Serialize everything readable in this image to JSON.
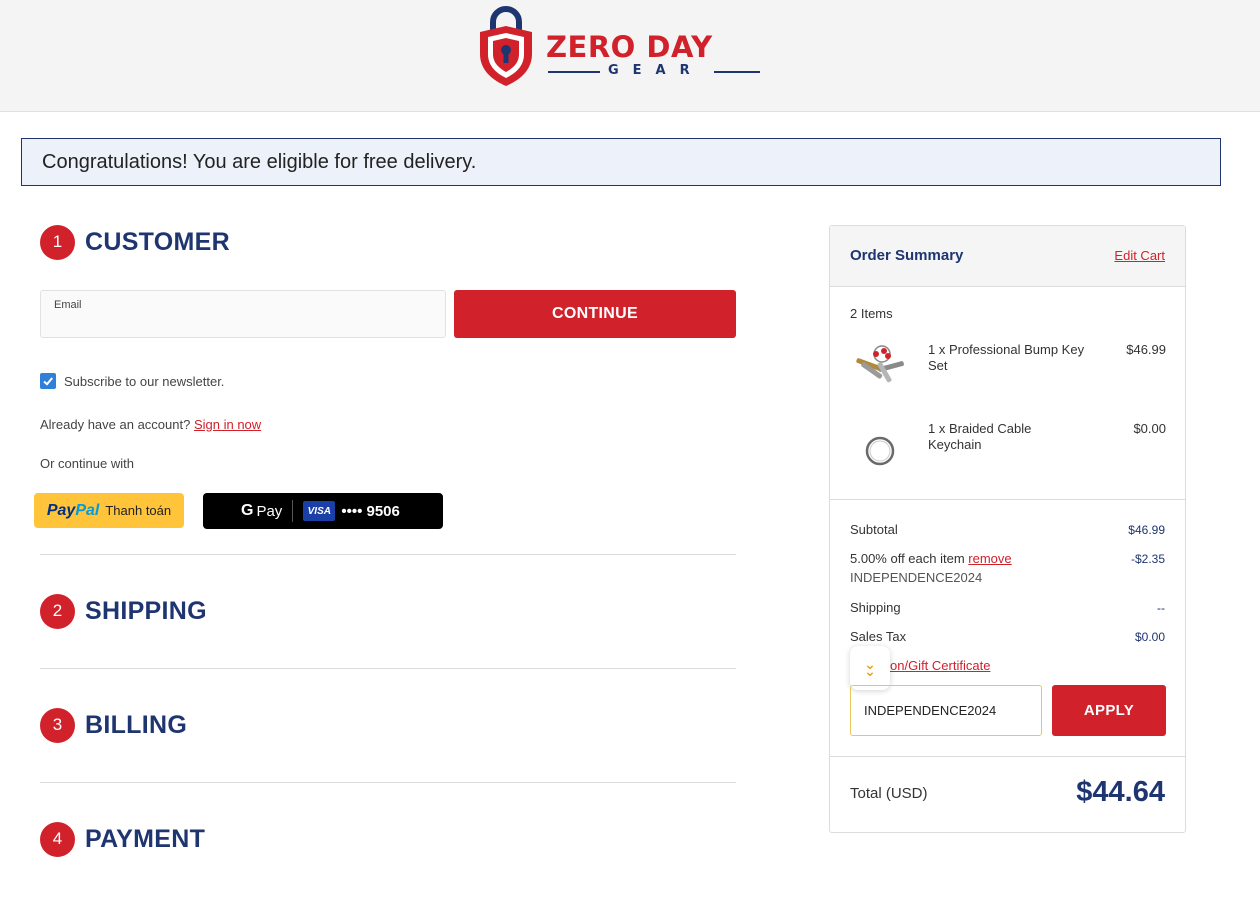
{
  "brand": {
    "name_line1": "ZERO DAY",
    "name_line2": "GEAR",
    "red": "#d1212b",
    "navy": "#1e3570"
  },
  "banner": {
    "message": "Congratulations! You are eligible for free delivery."
  },
  "customer": {
    "step_number": "1",
    "title": "CUSTOMER",
    "email_label": "Email",
    "email_value": "",
    "continue_label": "CONTINUE",
    "newsletter_label": "Subscribe to our newsletter.",
    "newsletter_checked": true,
    "account_prompt": "Already have an account?",
    "sign_in_label": "Sign in now",
    "continue_with": "Or continue with",
    "paypal_pay": "Pay",
    "paypal_pal": "Pal",
    "paypal_text": "Thanh toán",
    "gpay_g": "G",
    "gpay_label": "Pay",
    "card_brand": "VISA",
    "card_digits": "•••• 9506"
  },
  "steps": [
    {
      "number": "2",
      "title": "SHIPPING"
    },
    {
      "number": "3",
      "title": "BILLING"
    },
    {
      "number": "4",
      "title": "PAYMENT"
    }
  ],
  "summary": {
    "title": "Order Summary",
    "edit_cart": "Edit Cart",
    "items_count": "2 Items",
    "items": [
      {
        "name": "1 x Professional Bump Key Set",
        "price": "$46.99",
        "icon": "keys-icon"
      },
      {
        "name": "1 x Braided Cable Keychain",
        "price": "$0.00",
        "icon": "keyring-icon"
      }
    ],
    "subtotal_label": "Subtotal",
    "subtotal_value": "$46.99",
    "discount_label": "5.00% off each item",
    "discount_remove": "remove",
    "discount_code": "INDEPENDENCE2024",
    "discount_value": "-$2.35",
    "shipping_label": "Shipping",
    "shipping_value": "--",
    "tax_label": "Sales Tax",
    "tax_value": "$0.00",
    "coupon_link": "on/Gift Certificate",
    "coupon_input_value": "INDEPENDENCE2024",
    "apply_label": "APPLY",
    "total_label": "Total (USD)",
    "total_value": "$44.64"
  }
}
